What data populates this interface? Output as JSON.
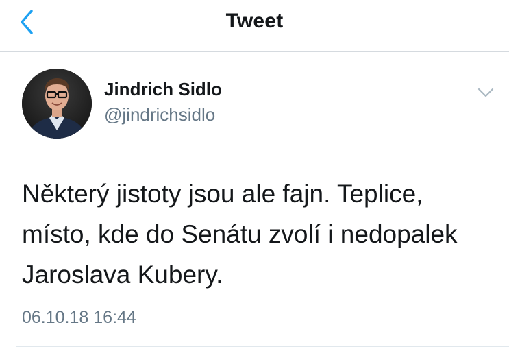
{
  "navbar": {
    "title": "Tweet",
    "back_icon": "chevron-left-icon",
    "accent_color": "#1da1f2"
  },
  "author": {
    "name": "Jindrich Sidlo",
    "handle": "@jindrichsidlo",
    "menu_icon": "chevron-down-icon"
  },
  "tweet": {
    "lines": [
      "Některý jistoty jsou ale fajn. Teplice,",
      "místo, kde do Senátu zvolí i nedopalek",
      "Jaroslava Kubery."
    ],
    "timestamp": "06.10.18 16:44"
  }
}
